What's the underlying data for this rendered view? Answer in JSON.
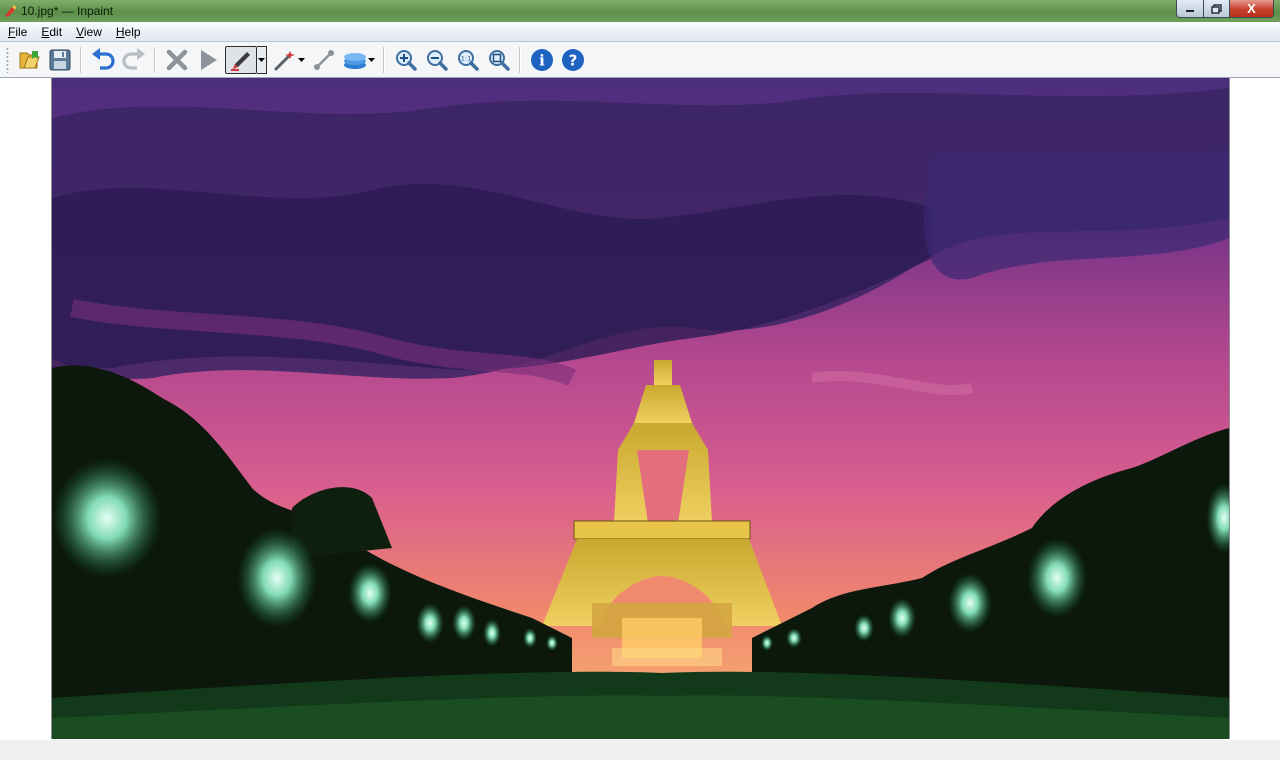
{
  "window": {
    "title": "10.jpg* — Inpaint",
    "controls": [
      "minimize",
      "restore",
      "close"
    ],
    "close_glyph": "X"
  },
  "menu": [
    {
      "label": "File"
    },
    {
      "label": "Edit"
    },
    {
      "label": "View"
    },
    {
      "label": "Help"
    }
  ],
  "toolbar": {
    "items": [
      "open-icon",
      "save-icon",
      "undo-icon",
      "redo-icon",
      "erase-icon",
      "run-icon",
      "marker-pen-icon",
      "magic-wand-icon",
      "guide-line-icon",
      "layers-icon",
      "zoom-in-icon",
      "zoom-out-icon",
      "actual-size-icon",
      "zoom-fit-icon",
      "info-icon",
      "help-icon"
    ],
    "zoom_1to1_label": "1:1",
    "info_glyph": "i",
    "help_glyph": "?"
  },
  "image": {
    "subject": "Eiffel Tower at dusk with purple-pink sky and illuminated trees",
    "colors": {
      "sky_top": "#4a2f78",
      "sky_mid": "#c8508f",
      "horizon": "#f08a6e",
      "tower": "#e8c440",
      "trees": "#0b1a0c",
      "lamps": "#9ff0d0"
    }
  }
}
